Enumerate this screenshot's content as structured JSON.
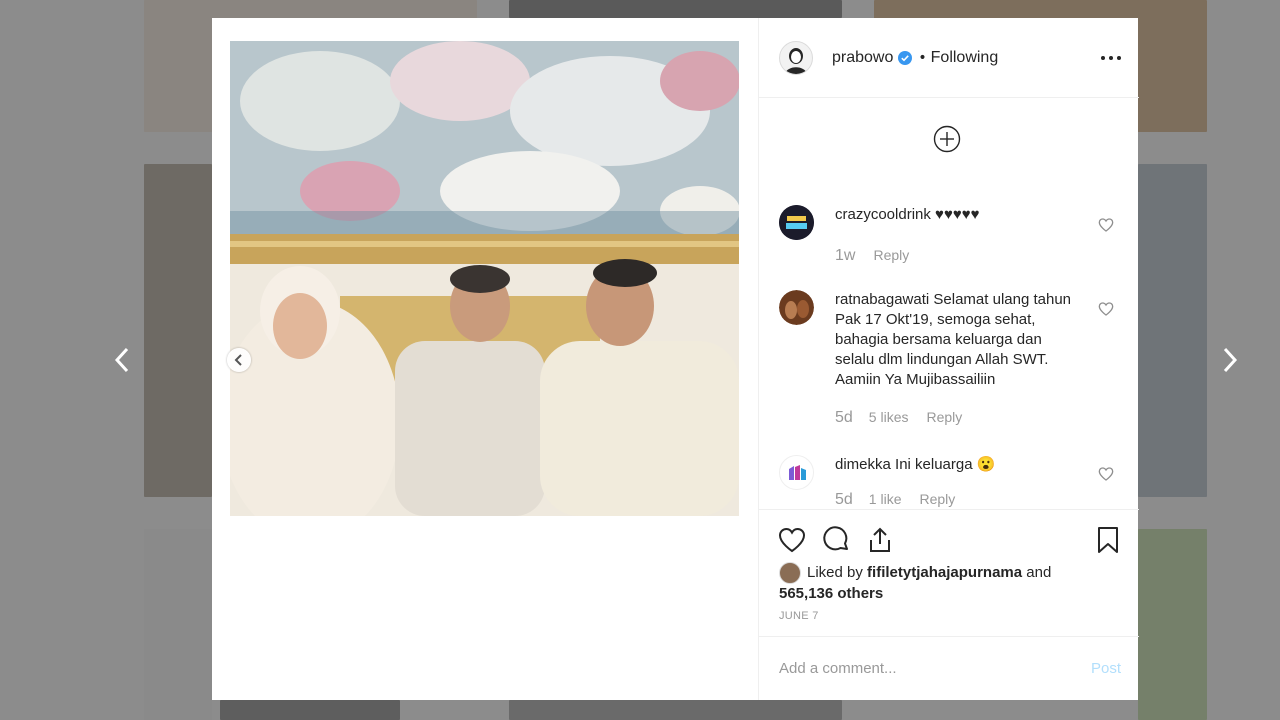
{
  "post": {
    "author": "prabowo",
    "verified": true,
    "separator": "•",
    "follow_status": "Following",
    "more_icon": "more-horizontal-icon",
    "load_more_icon": "plus-circle-icon",
    "comments": [
      {
        "username": "crazycooldrink",
        "text": "♥♥♥♥♥",
        "time": "1w",
        "likes": "",
        "reply": "Reply",
        "avatar": "crazycool-logo-avatar"
      },
      {
        "username": "ratnabagawati",
        "text": "Selamat ulang tahun Pak 17 Okt'19, semoga sehat, bahagia bersama keluarga dan selalu dlm lindungan Allah SWT. Aamiin Ya Mujibassailiin",
        "time": "5d",
        "likes": "5 likes",
        "reply": "Reply",
        "avatar": "photo-avatar"
      },
      {
        "username": "dimekka",
        "text": "Ini keluarga 😮",
        "time": "5d",
        "likes": "1 like",
        "reply": "Reply",
        "avatar": "dimekka-logo-avatar"
      }
    ],
    "liked_by_prefix": "Liked by",
    "liked_by_user": "fifiletytjahajapurnama",
    "liked_by_and": "and",
    "liked_by_others": "565,136 others",
    "date": "JUNE 7",
    "comment_placeholder": "Add a comment...",
    "post_label": "Post"
  },
  "colors": {
    "verified_blue": "#3897f0",
    "post_button": "#b2dffc",
    "muted_text": "#999999"
  }
}
